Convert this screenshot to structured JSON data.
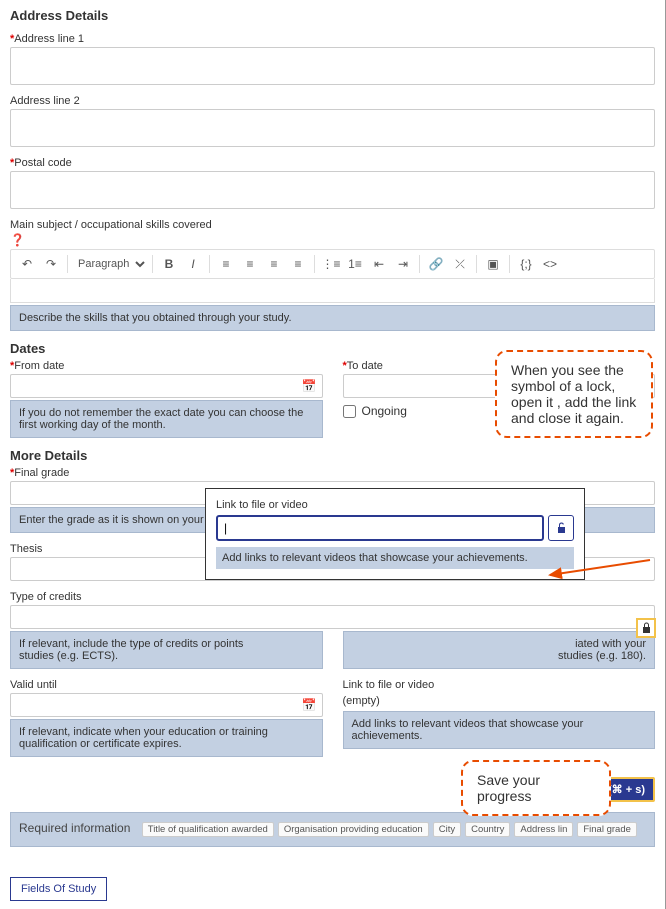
{
  "sections": {
    "address_title": "Address Details",
    "dates_title": "Dates",
    "more_title": "More Details"
  },
  "labels": {
    "addr1": "Address line 1",
    "addr2": "Address line 2",
    "postal": "Postal code",
    "main_subject": "Main subject / occupational skills covered",
    "from_date": "From date",
    "to_date": "To date",
    "ongoing": "Ongoing",
    "final_grade": "Final grade",
    "thesis": "Thesis",
    "type_credits": "Type of credits",
    "valid_until": "Valid until",
    "link_file": "Link to file or video",
    "empty": "(empty)"
  },
  "rte": {
    "paragraph": "Paragraph"
  },
  "hints": {
    "skills": "Describe the skills that you obtained through your study.",
    "from_date": "If you do not remember the exact date you can choose the first working day of the month.",
    "final_grade": "Enter the grade as it is shown on your diploma/certificate. It can be a number, percentage, letter or words (e.g. 2.1,",
    "type_credits": "If relevant, include the type of credits or points",
    "studies_eg": "studies (e.g. ECTS).",
    "credits_right": "iated with your studies (e.g. 180).",
    "valid_until": "If relevant, indicate when your education or training qualification or certificate expires.",
    "link_hint": "Add links to relevant videos that showcase your achievements."
  },
  "popup": {
    "label": "Link to file or video",
    "hint": "Add links to relevant videos that showcase your achievements."
  },
  "callouts": {
    "lock": "When you see the symbol of a lock, open it , add the link and close it again.",
    "save": "Save your progress"
  },
  "buttons": {
    "save": "Save (⌘ + s)",
    "fields": "Fields Of Study"
  },
  "required": {
    "title": "Required information",
    "tags": [
      "Title of qualification awarded",
      "Organisation providing education",
      "City",
      "Country",
      "Address lin",
      "Final grade"
    ]
  }
}
